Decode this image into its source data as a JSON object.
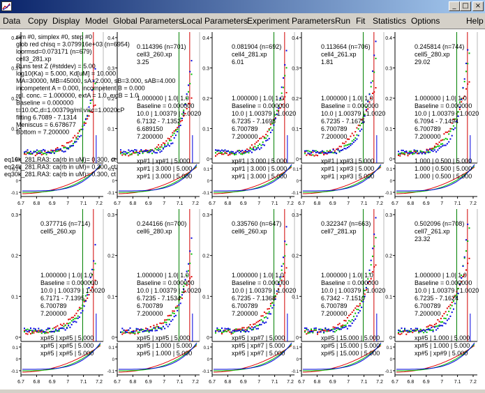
{
  "window": {
    "minimize_glyph": "_",
    "maximize_glyph": "□",
    "close_glyph": "×"
  },
  "menu": [
    "Data",
    "Copy",
    "Display",
    "Model",
    "Global Parameters",
    "Local Parameters",
    "Experiment Parameters",
    "Run",
    "Fit",
    "Statistics",
    "Options",
    "Help"
  ],
  "info_block": [
    "sim #0, simplex #0, step #0",
    "glob red chisq = 3.079916e+03 (n=6954)",
    "loormsd=0.073171 (n=679)",
    "cell3_281.xp",
    "Runs test Z (#stddev) = 5.00",
    "log10(Ka) = 5.000, Kd[uM] = 10.000",
    "MA=30000, MB=45000, sA=2.000, sB=3.000, sAB=4.000",
    "incompetent A = 0.000, incompetent B = 0.000",
    "rel. conc. = 1.000000, extA = 1.0, extB = 1.0",
    "Baseline = 0.000000",
    "t=10.0C,d=1.00379g/ml,visc=1.0020cP",
    "fitting 6.7089 - 7.1314",
    "Meniscus = 6.678677",
    "Bottom = 7.200000"
  ],
  "eq_lines": [
    "eq16k_281.RA3: ca(rb in uM)= 0.300, ct",
    "eq24k_281.RA3: ca(rb in uM)= 0.300, ct",
    "eq30k_281.RA3: ca(rb in uM)= 0.300, ct"
  ],
  "panels": [
    {
      "header": [
        "0.114396 (n=701)",
        "cell3_260.xp",
        "3.25"
      ],
      "mid": [
        "1.000000 | 1.0| 1.0",
        "Baseline = 0.000000",
        "10.0 | 1.00379 | 1.0020",
        "6.7132 - 7.1352",
        "6.689150",
        "7.200000"
      ],
      "bottom": [
        "xp#1 | xp#1 | 5.000",
        "xp#1 | 3.000 | 5.000",
        "xp#1 | 3.000 | 5.000"
      ]
    },
    {
      "header": [
        "0.081904 (n=692)",
        "cell4_281.xp",
        "6.01"
      ],
      "mid": [
        "1.000000 | 1.0| 1.0",
        "Baseline = 0.000000",
        "10.0 | 1.00379 | 1.0020",
        "6.7235 - 7.1698",
        "6.700789",
        "7.200000"
      ],
      "bottom": [
        "xp#1 | 3.000 | 5.000",
        "xp#1 | 3.000 | 5.000",
        "xp#1 | 3.000 | 5.000"
      ]
    },
    {
      "header": [
        "0.113664 (n=706)",
        "cell4_261.xp",
        "1.81"
      ],
      "mid": [
        "1.000000 | 1.0| 1.0",
        "Baseline = 0.000000",
        "10.0 | 1.00379 | 1.0020",
        "6.7235 - 7.1675",
        "6.700789",
        "7.200000"
      ],
      "bottom": [
        "xp#1 | xp#3 | 5.000",
        "xp#1 | xp#3 | 5.000",
        "xp#1 | xp#3 | 5.000"
      ]
    },
    {
      "header": [
        "0.245814 (n=744)",
        "cell5_280.xp",
        "29.02"
      ],
      "mid": [
        "1.000000 | 1.0| 1.0",
        "Baseline = 0.000000",
        "10.0 | 1.00379 | 1.0020",
        "6.7094 - 7.1494",
        "6.700789",
        "7.200000"
      ],
      "bottom": [
        "1.000 | 0.500 | 5.000",
        "1.000 | 0.500 | 5.000",
        "1.000 | 0.500 | 5.000"
      ]
    },
    {
      "header": [
        "0.377716 (n=714)",
        "cell5_260.xp",
        ""
      ],
      "mid": [
        "1.000000 | 1.0| 1.0",
        "Baseline = 0.000000",
        "10.0 | 1.00379 | 1.0020",
        "6.7171 - 7.1395",
        "6.700789",
        "7.200000"
      ],
      "bottom": [
        "xp#5 | xp#5 | 5.000",
        "xp#5 | xp#5 | 5.000",
        "xp#5 | xp#5 | 5.000"
      ]
    },
    {
      "header": [
        "0.244166 (n=700)",
        "cell6_280.xp",
        ""
      ],
      "mid": [
        "1.000000 | 1.0| 1.0",
        "Baseline = 0.000000",
        "10.0 | 1.00379 | 1.0020",
        "6.7235 - 7.1534",
        "6.700789",
        "7.200000"
      ],
      "bottom": [
        "xp#5 | xp#5 | 5.000",
        "xp#5 | 1.000 | 5.000",
        "xp#5 | 1.000 | 5.000"
      ]
    },
    {
      "header": [
        "0.335760 (n=647)",
        "cell6_260.xp",
        ""
      ],
      "mid": [
        "1.000000 | 1.0| 1.0",
        "Baseline = 0.000000",
        "10.0 | 1.00379 | 1.0020",
        "6.7235 - 7.1368",
        "6.700789",
        "7.200000"
      ],
      "bottom": [
        "xp#5 | xp#7 | 5.000",
        "xp#5 | xp#7 | 5.000",
        "xp#5 | xp#7 | 5.000"
      ]
    },
    {
      "header": [
        "0.322347 (n=663)",
        "cell7_281.xp",
        ""
      ],
      "mid": [
        "1.000000 | 1.0| 1.0",
        "Baseline = 0.000000",
        "10.0 | 1.00379 | 1.0020",
        "6.7342 - 7.1510",
        "6.700789",
        "7.200000"
      ],
      "bottom": [
        "xp#5 | 15.000 | 5.000",
        "xp#5 | 15.000 | 5.000",
        "xp#5 | 15.000 | 5.000"
      ]
    },
    {
      "header": [
        "0.502096 (n=708)",
        "cell7_261.xp",
        "23.32"
      ],
      "mid": [
        "1.000000 | 1.0| 1.0",
        "Baseline = 0.000000",
        "10.0 | 1.00379 | 1.0020",
        "6.7235 - 7.1624",
        "6.700789",
        "7.200000"
      ],
      "bottom": [
        "xp#5 | 1.000 | 5.000",
        "xp#5 | 1.000 | 5.000",
        "xp#5 | xp#9 | 5.000"
      ]
    }
  ],
  "y_ticks_main_top": [
    "0.4",
    "0.3",
    "0.2",
    "0.1",
    "0"
  ],
  "y_ticks_main_bot": [
    "0.3",
    "0.2",
    "0.1",
    "0"
  ],
  "y_ticks_small": [
    "0.1",
    "0",
    "-0.1"
  ],
  "x_ticks": [
    "6.7",
    "6.8",
    "6.9",
    "7",
    "7.1",
    "7.2"
  ],
  "colors": {
    "red": "#e00000",
    "green": "#00c000",
    "blue": "#0000e0",
    "axis": "#000000",
    "vline": "#008000"
  }
}
